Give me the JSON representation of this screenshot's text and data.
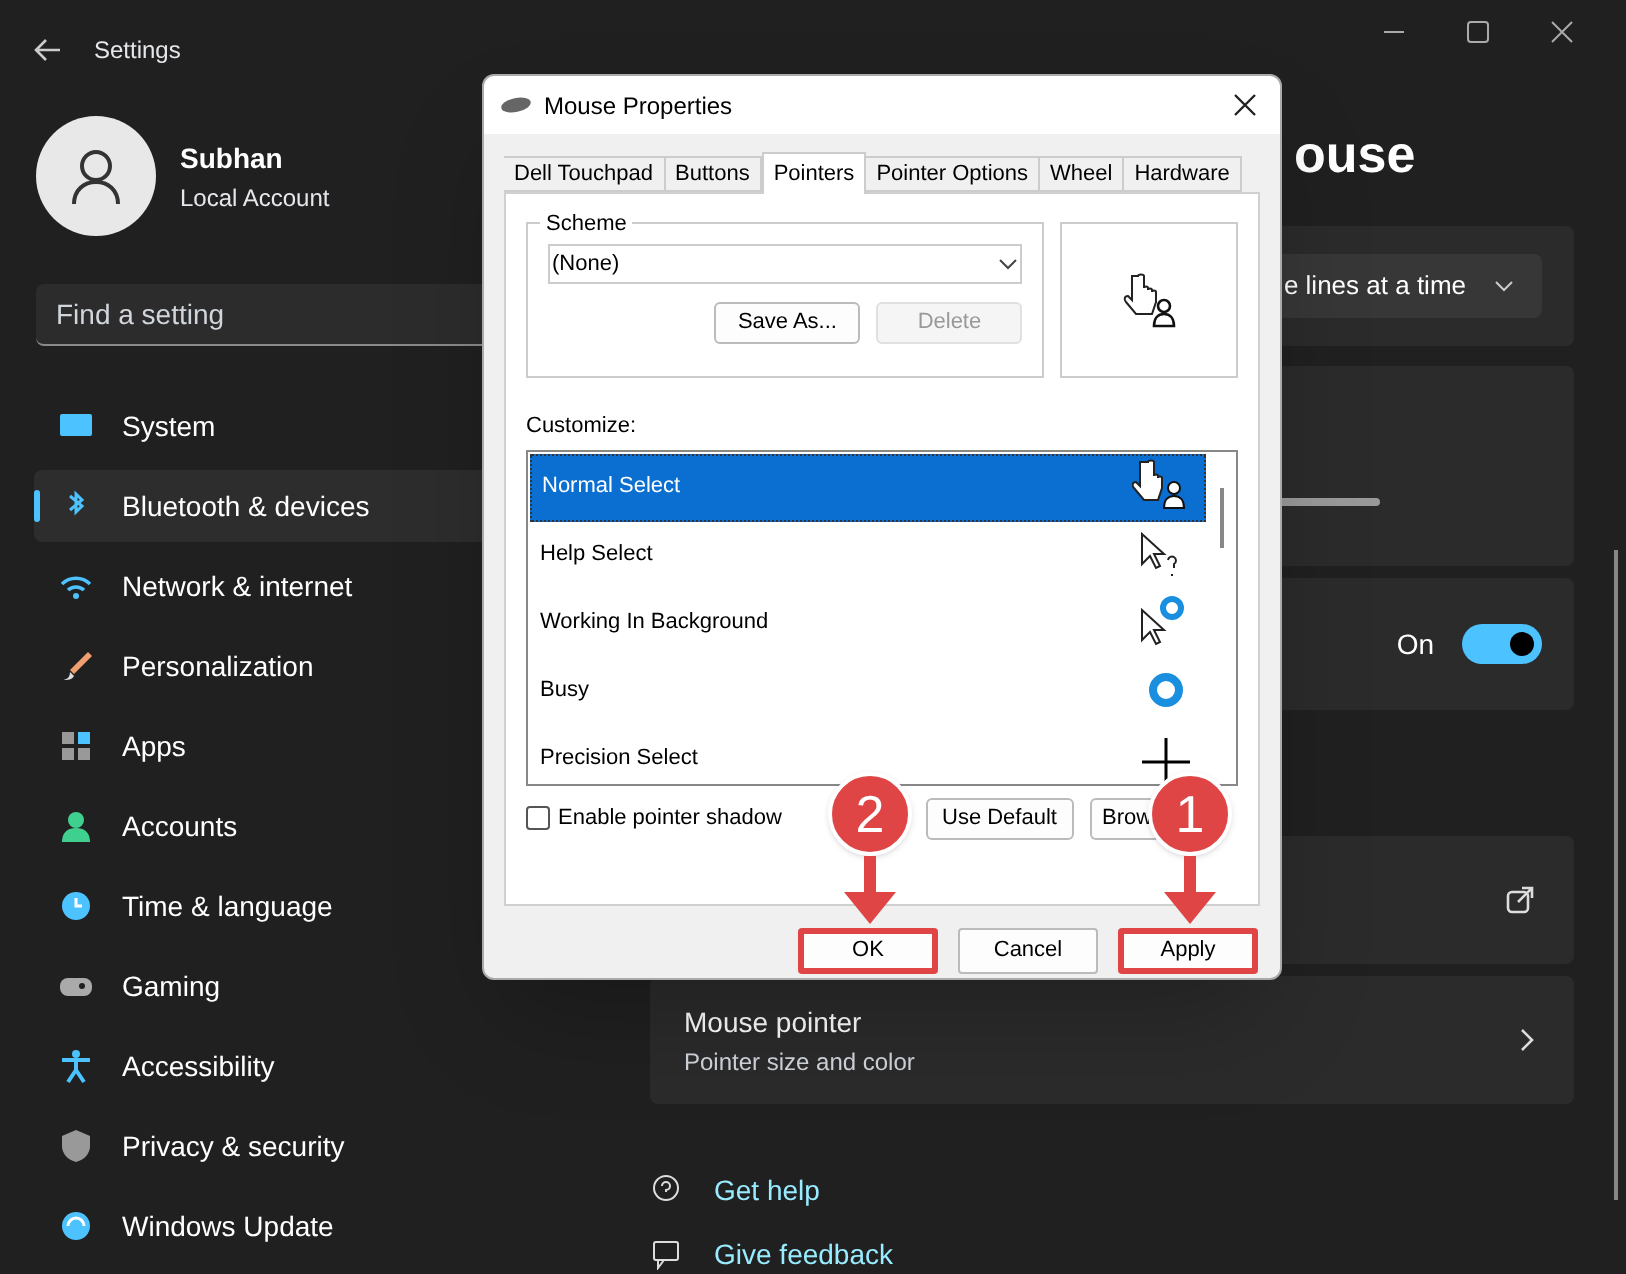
{
  "window": {
    "title": "Settings"
  },
  "account": {
    "name": "Subhan",
    "type": "Local Account"
  },
  "search": {
    "placeholder": "Find a setting"
  },
  "sidebar": {
    "items": [
      {
        "label": "System",
        "selected": false
      },
      {
        "label": "Bluetooth & devices",
        "selected": true
      },
      {
        "label": "Network & internet",
        "selected": false
      },
      {
        "label": "Personalization",
        "selected": false
      },
      {
        "label": "Apps",
        "selected": false
      },
      {
        "label": "Accounts",
        "selected": false
      },
      {
        "label": "Time & language",
        "selected": false
      },
      {
        "label": "Gaming",
        "selected": false
      },
      {
        "label": "Accessibility",
        "selected": false
      },
      {
        "label": "Privacy & security",
        "selected": false
      },
      {
        "label": "Windows Update",
        "selected": false
      }
    ]
  },
  "page": {
    "title": "ouse",
    "scroll_dropdown": {
      "value": "e lines at a time"
    },
    "toggle": {
      "label": "On",
      "on": true
    },
    "cards": [
      {
        "kind": "link"
      },
      {
        "kind": "nav",
        "title": "Mouse pointer",
        "subtitle": "Pointer size and color"
      }
    ],
    "help_links": [
      {
        "label": "Get help"
      },
      {
        "label": "Give feedback"
      }
    ]
  },
  "dialog": {
    "title": "Mouse Properties",
    "tabs": [
      {
        "label": "Dell Touchpad",
        "selected": false
      },
      {
        "label": "Buttons",
        "selected": false
      },
      {
        "label": "Pointers",
        "selected": true
      },
      {
        "label": "Pointer Options",
        "selected": false
      },
      {
        "label": "Wheel",
        "selected": false
      },
      {
        "label": "Hardware",
        "selected": false
      }
    ],
    "scheme": {
      "label": "Scheme",
      "value": "(None)",
      "buttons": [
        {
          "label": "Save As...",
          "disabled": false
        },
        {
          "label": "Delete",
          "disabled": true
        }
      ]
    },
    "customize": {
      "label": "Customize:",
      "items": [
        {
          "label": "Normal Select",
          "selected": true
        },
        {
          "label": "Help Select",
          "selected": false
        },
        {
          "label": "Working In Background",
          "selected": false
        },
        {
          "label": "Busy",
          "selected": false
        },
        {
          "label": "Precision Select",
          "selected": false
        }
      ]
    },
    "shadow": {
      "label": "Enable pointer shadow",
      "checked": false
    },
    "list_buttons": [
      {
        "label": "Use Default"
      },
      {
        "label": "Brow"
      }
    ],
    "buttons": [
      {
        "label": "OK",
        "highlighted": true,
        "callout": "2"
      },
      {
        "label": "Cancel",
        "highlighted": false
      },
      {
        "label": "Apply",
        "highlighted": true,
        "callout": "1"
      }
    ]
  }
}
